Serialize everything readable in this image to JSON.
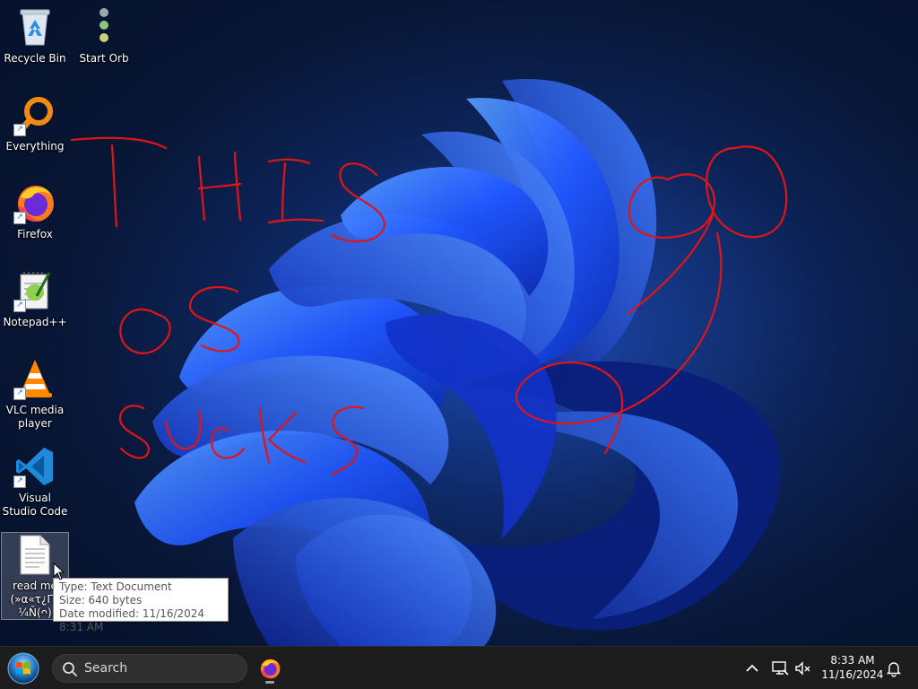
{
  "desktop": {
    "icons": [
      {
        "label": "Recycle Bin",
        "icon": "recycle-bin-icon"
      },
      {
        "label": "Start Orb",
        "icon": "start-orb-app-icon"
      },
      {
        "label": "Everything",
        "icon": "everything-search-icon"
      },
      {
        "label": "Firefox",
        "icon": "firefox-icon"
      },
      {
        "label": "Notepad++",
        "icon": "notepad-plus-plus-icon"
      },
      {
        "label": "VLC media player",
        "icon": "vlc-icon"
      },
      {
        "label": "Visual Studio Code",
        "icon": "vscode-icon"
      },
      {
        "label": "read me (»α«τ¿Γá ¼Ñ(ᴖ)",
        "icon": "text-document-icon"
      }
    ],
    "scribble_text": [
      "THIS",
      "OS",
      "SUCKS"
    ]
  },
  "tooltip": {
    "type": "Type: Text Document",
    "size": "Size: 640 bytes",
    "modified": "Date modified: 11/16/2024 8:31 AM"
  },
  "taskbar": {
    "search_placeholder": "Search",
    "time": "8:33 AM",
    "date": "11/16/2024"
  },
  "colors": {
    "accent_blue": "#2f6bff",
    "scribble_red": "#e01515",
    "taskbar_bg": "#1c1c1c"
  }
}
